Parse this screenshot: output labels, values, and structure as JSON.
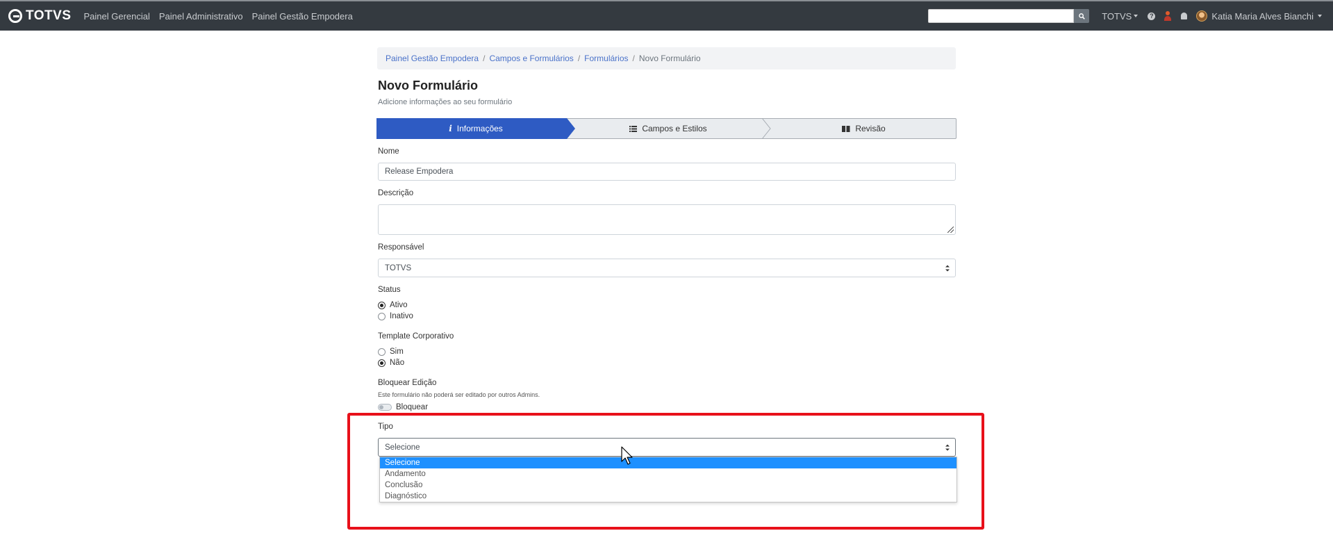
{
  "navbar": {
    "brand": "TOTVS",
    "links": [
      "Painel Gerencial",
      "Painel Administrativo",
      "Painel Gestão Empodera"
    ],
    "search": {
      "value": "",
      "placeholder": ""
    },
    "org_menu": "TOTVS",
    "user_name": "Katia Maria Alves Bianchi"
  },
  "breadcrumb": {
    "items": [
      "Painel Gestão Empodera",
      "Campos e Formulários",
      "Formulários"
    ],
    "current": "Novo Formulário"
  },
  "page": {
    "title": "Novo Formulário",
    "subtitle": "Adicione informações ao seu formulário"
  },
  "steps": [
    {
      "label": "Informações",
      "icon": "info-icon",
      "active": true
    },
    {
      "label": "Campos e Estilos",
      "icon": "list-icon",
      "active": false
    },
    {
      "label": "Revisão",
      "icon": "book-icon",
      "active": false
    }
  ],
  "form": {
    "nome": {
      "label": "Nome",
      "value": "Release Empodera"
    },
    "descricao": {
      "label": "Descrição",
      "value": ""
    },
    "responsavel": {
      "label": "Responsável",
      "value": "TOTVS"
    },
    "status": {
      "label": "Status",
      "options": [
        "Ativo",
        "Inativo"
      ],
      "selected": "Ativo"
    },
    "template": {
      "label": "Template Corporativo",
      "options": [
        "Sim",
        "Não"
      ],
      "selected": "Não"
    },
    "bloquear": {
      "label": "Bloquear Edição",
      "note": "Este formulário não poderá ser editado por outros Admins.",
      "toggle_label": "Bloquear",
      "on": false
    },
    "tipo": {
      "label": "Tipo",
      "value": "Selecione",
      "options": [
        "Selecione",
        "Andamento",
        "Conclusão",
        "Diagnóstico"
      ],
      "highlighted": "Selecione"
    }
  },
  "colors": {
    "navbar": "#343a40",
    "primary_step": "#2e5bc3",
    "link": "#4a72c9",
    "highlight_box": "#e8101a",
    "option_selected": "#1e90ff"
  }
}
